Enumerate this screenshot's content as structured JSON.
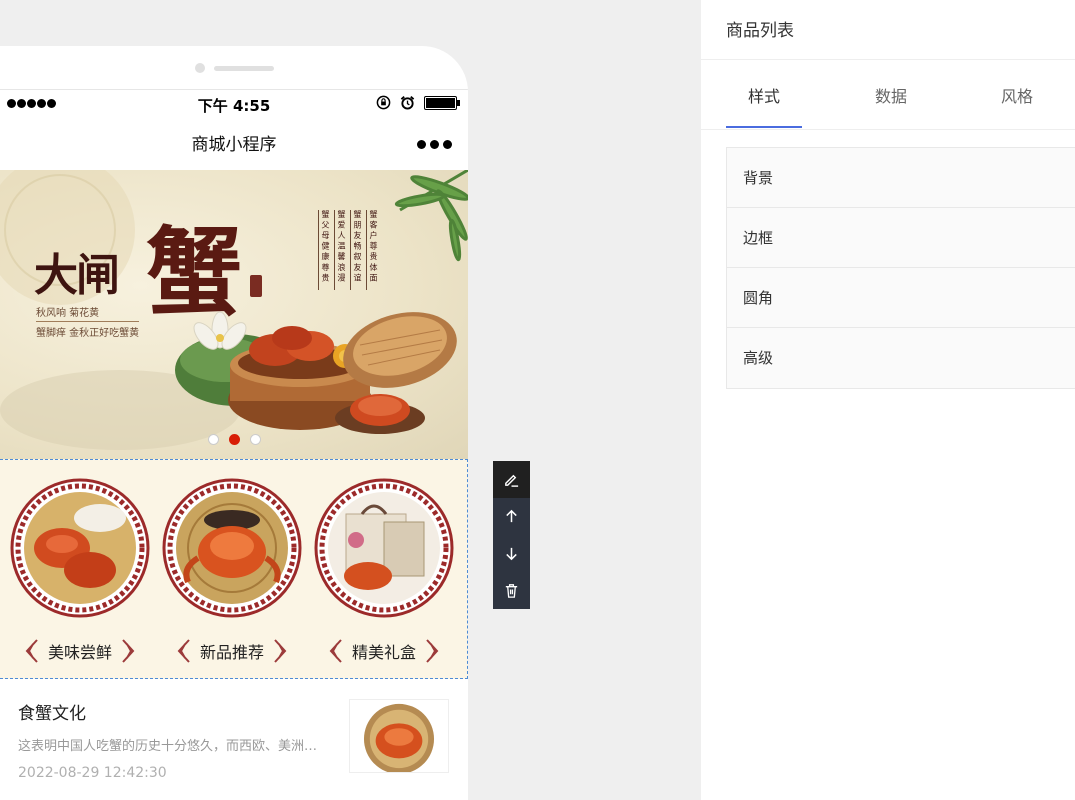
{
  "phone": {
    "status": {
      "time": "下午 4:55"
    },
    "nav": {
      "title": "商城小程序"
    },
    "banner": {
      "title_small": "大闸",
      "title_big": "蟹",
      "tagline1": "秋风响  菊花黄",
      "tagline2": "蟹脚痒  金秋正好吃蟹黄",
      "poem_cols": [
        "蟹 父 母 健 康 尊 贵",
        "蟹 爱 人 温 馨 浪 漫",
        "蟹 朋 友 畅 叙 友 谊",
        "蟹 客 户 尊 贵 体 面"
      ],
      "slide_count": 3,
      "active_slide": 2
    },
    "categories": [
      {
        "label": "美味尝鲜",
        "image": "steamed-crabs-plate"
      },
      {
        "label": "新品推荐",
        "image": "single-crab"
      },
      {
        "label": "精美礼盒",
        "image": "gift-box"
      }
    ],
    "article": {
      "title": "食蟹文化",
      "description": "这表明中国人吃蟹的历史十分悠久，而西欧、美洲人很少吃蟹",
      "date": "2022-08-29 12:42:30"
    }
  },
  "toolbar": {
    "buttons": [
      "edit-icon",
      "arrow-up-icon",
      "arrow-down-icon",
      "trash-icon"
    ]
  },
  "panel": {
    "title": "商品列表",
    "tabs": [
      {
        "label": "样式",
        "active": true
      },
      {
        "label": "数据",
        "active": false
      },
      {
        "label": "风格",
        "active": false
      }
    ],
    "sections": [
      "背景",
      "边框",
      "圆角",
      "高级"
    ]
  },
  "colors": {
    "accent": "#4a6cdf",
    "banner_dot_active": "#d81e06",
    "toolbar_bg": "#2e3440",
    "category_bg": "#fbf5e5"
  }
}
